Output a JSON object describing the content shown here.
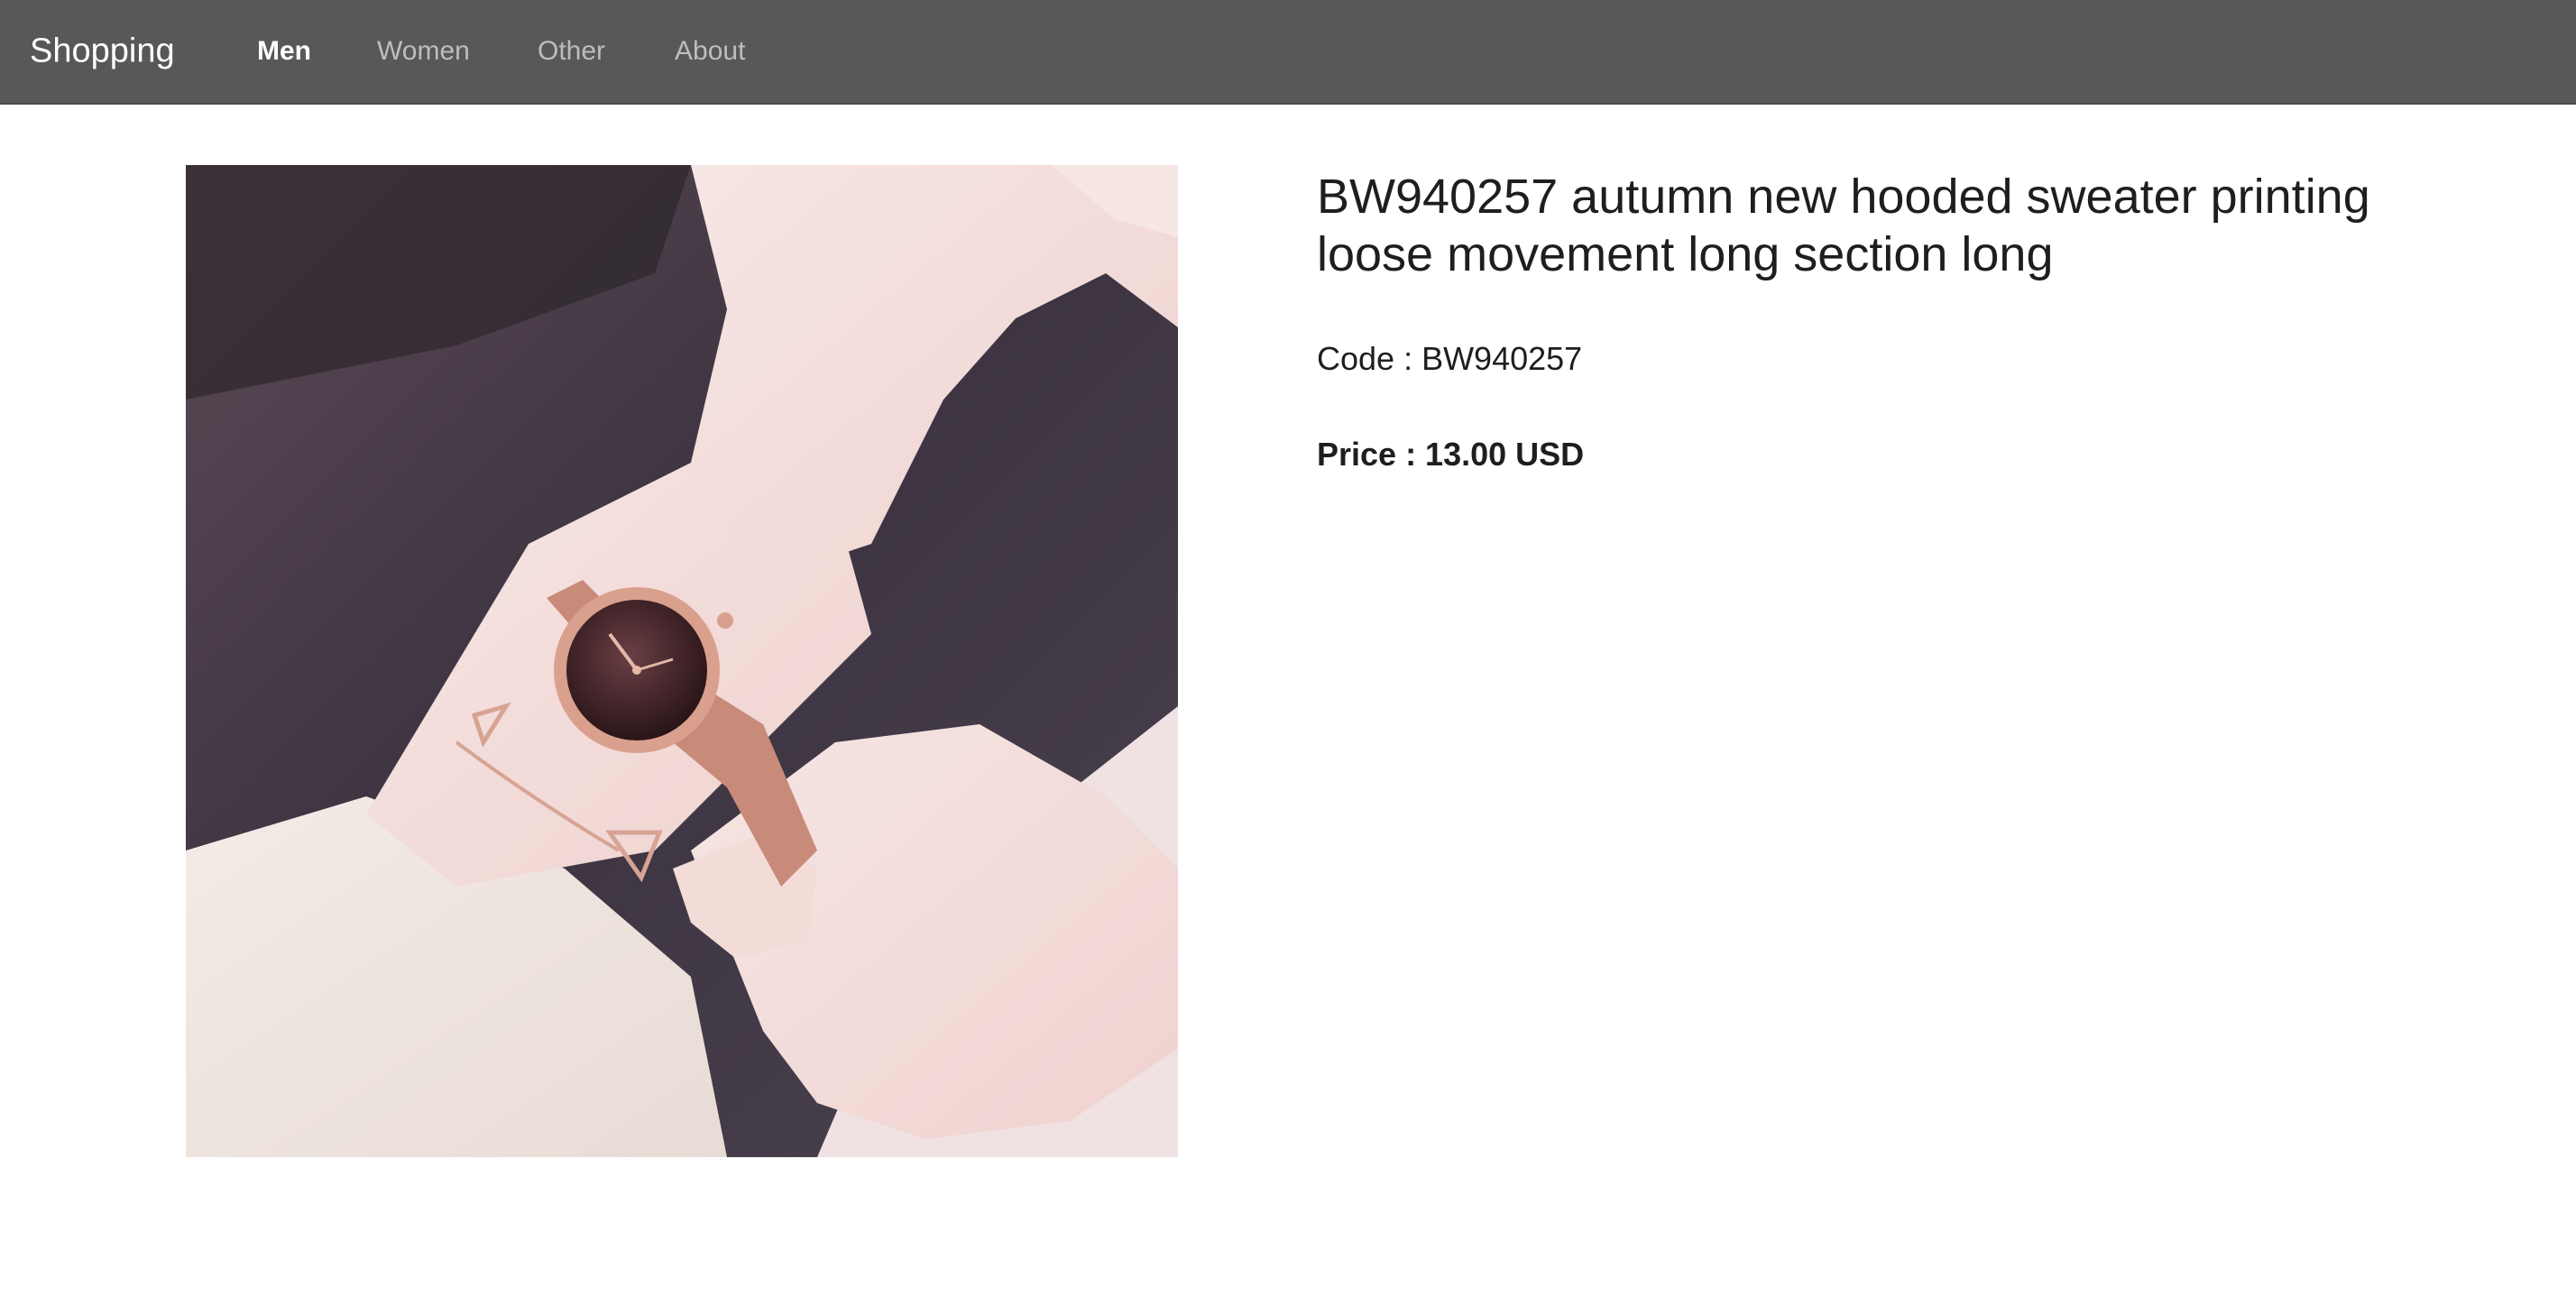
{
  "navbar": {
    "brand": "Shopping",
    "items": [
      {
        "label": "Men",
        "active": true
      },
      {
        "label": "Women",
        "active": false
      },
      {
        "label": "Other",
        "active": false
      },
      {
        "label": "About",
        "active": false
      }
    ]
  },
  "product": {
    "image_icon": "wristwatch-photo",
    "title": "BW940257 autumn new hooded sweater printing loose movement long section long",
    "code": "Code : BW940257",
    "price": "Price : 13.00 USD"
  },
  "colors": {
    "navbar_bg": "#585858",
    "nav_active": "#ffffff",
    "nav_inactive": "#bdbdbd",
    "page_bg": "#ffffff",
    "text": "#1e1e1e"
  }
}
